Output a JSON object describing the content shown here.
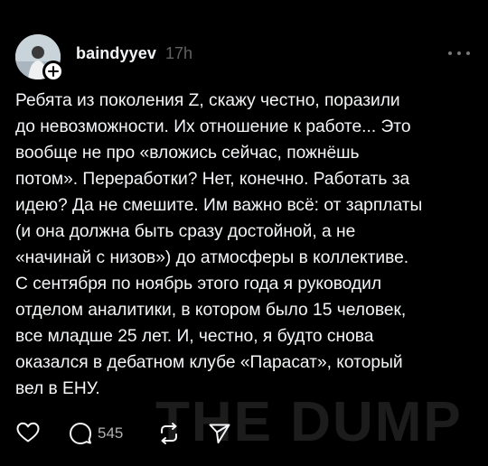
{
  "post": {
    "username": "baindyyev",
    "time": "17h",
    "body": "Ребята из поколения Z, скажу честно, поразили\nдо невозможности. Их отношение к работе... Это\nвообще не про «вложись сейчас, пожнёшь\nпотом». Переработки? Нет, конечно. Работать за\nидею? Да не смешите. Им важно всё: от зарплаты\n(и она должна быть сразу достойной, а не\n«начинай с низов») до атмосферы в коллективе.\nС сентября по ноябрь этого года я руководил\nотделом аналитики, в котором было 15 человек,\nвсе младше 25 лет. И, честно, я будто снова\nоказался в дебатном клубе «Парасат», который\nвел в ЕНУ.",
    "reply_count": "545",
    "watermark": "THE DUMP"
  },
  "icons": {
    "avatar": "user-avatar",
    "follow": "plus-icon",
    "more": "more-icon",
    "like": "heart-icon",
    "reply": "comment-icon",
    "repost": "repost-icon",
    "share": "send-icon"
  },
  "colors": {
    "background": "#000000",
    "text": "#f3f5f7",
    "muted": "#616161"
  }
}
